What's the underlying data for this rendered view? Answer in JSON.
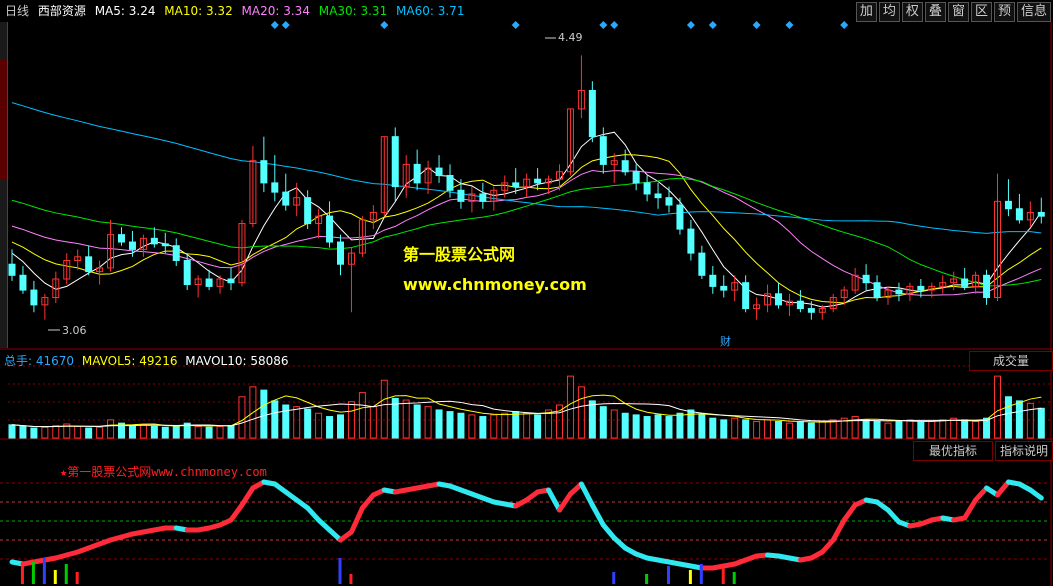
{
  "header": {
    "period": "日线",
    "stock_name": "西部资源",
    "ma5": "MA5: 3.24",
    "ma10": "MA10: 3.32",
    "ma20": "MA20: 3.34",
    "ma30": "MA30: 3.31",
    "ma60": "MA60: 3.71"
  },
  "toolbar": [
    "加",
    "均",
    "权",
    "叠",
    "窗",
    "区",
    "预",
    "信息"
  ],
  "watermark": {
    "cn": "第一股票公式网",
    "url": "www.chnmoney.com"
  },
  "price_labels": {
    "high": "4.49",
    "low": "3.06"
  },
  "finance_marker": "财",
  "volume_header": {
    "total": "总手: 41670",
    "mavol5": "MAVOL5: 49216",
    "mavol10": "MAVOL10: 58086"
  },
  "volume_button": "成交量",
  "indicator_buttons": {
    "best": "最优指标",
    "explain": "指标说明"
  },
  "indicator_title": "★第一股票公式网www.chnmoney.com",
  "colors": {
    "up": "#ff3232",
    "down": "#54ffff",
    "ma5": "#ffffff",
    "ma10": "#ffff00",
    "ma20": "#ff80ff",
    "ma30": "#00e600",
    "ma60": "#00c0ff",
    "grid_red": "#8b0000"
  },
  "chart_data": {
    "type": "candlestick",
    "y_range": [
      2.95,
      4.6
    ],
    "candles": [
      [
        3.36,
        3.44,
        3.27,
        3.3
      ],
      [
        3.3,
        3.35,
        3.2,
        3.22
      ],
      [
        3.22,
        3.27,
        3.1,
        3.14
      ],
      [
        3.14,
        3.2,
        3.06,
        3.18
      ],
      [
        3.18,
        3.32,
        3.15,
        3.28
      ],
      [
        3.28,
        3.42,
        3.25,
        3.38
      ],
      [
        3.38,
        3.44,
        3.33,
        3.4
      ],
      [
        3.4,
        3.46,
        3.3,
        3.32
      ],
      [
        3.32,
        3.38,
        3.25,
        3.34
      ],
      [
        3.34,
        3.6,
        3.32,
        3.52
      ],
      [
        3.52,
        3.56,
        3.46,
        3.48
      ],
      [
        3.48,
        3.54,
        3.4,
        3.44
      ],
      [
        3.44,
        3.52,
        3.4,
        3.5
      ],
      [
        3.5,
        3.56,
        3.45,
        3.47
      ],
      [
        3.47,
        3.53,
        3.42,
        3.46
      ],
      [
        3.46,
        3.5,
        3.35,
        3.38
      ],
      [
        3.38,
        3.42,
        3.22,
        3.25
      ],
      [
        3.25,
        3.3,
        3.18,
        3.28
      ],
      [
        3.28,
        3.33,
        3.22,
        3.24
      ],
      [
        3.24,
        3.3,
        3.2,
        3.28
      ],
      [
        3.28,
        3.34,
        3.22,
        3.26
      ],
      [
        3.26,
        3.6,
        3.24,
        3.58
      ],
      [
        3.58,
        4.0,
        3.56,
        3.92
      ],
      [
        3.92,
        4.05,
        3.75,
        3.8
      ],
      [
        3.8,
        3.95,
        3.7,
        3.75
      ],
      [
        3.75,
        3.85,
        3.65,
        3.68
      ],
      [
        3.68,
        3.8,
        3.62,
        3.72
      ],
      [
        3.72,
        3.76,
        3.55,
        3.58
      ],
      [
        3.58,
        3.66,
        3.5,
        3.62
      ],
      [
        3.62,
        3.7,
        3.45,
        3.48
      ],
      [
        3.48,
        3.52,
        3.3,
        3.36
      ],
      [
        3.36,
        3.45,
        3.1,
        3.42
      ],
      [
        3.42,
        3.62,
        3.4,
        3.6
      ],
      [
        3.6,
        3.68,
        3.55,
        3.64
      ],
      [
        3.64,
        4.05,
        3.62,
        4.05
      ],
      [
        4.05,
        4.1,
        3.7,
        3.78
      ],
      [
        3.78,
        3.95,
        3.72,
        3.9
      ],
      [
        3.9,
        3.98,
        3.76,
        3.8
      ],
      [
        3.8,
        3.92,
        3.74,
        3.88
      ],
      [
        3.88,
        3.95,
        3.8,
        3.84
      ],
      [
        3.84,
        3.9,
        3.72,
        3.76
      ],
      [
        3.76,
        3.82,
        3.66,
        3.7
      ],
      [
        3.7,
        3.78,
        3.64,
        3.74
      ],
      [
        3.74,
        3.8,
        3.66,
        3.7
      ],
      [
        3.7,
        3.78,
        3.65,
        3.76
      ],
      [
        3.76,
        3.84,
        3.72,
        3.8
      ],
      [
        3.8,
        3.88,
        3.74,
        3.78
      ],
      [
        3.78,
        3.85,
        3.72,
        3.82
      ],
      [
        3.82,
        3.88,
        3.76,
        3.8
      ],
      [
        3.8,
        3.84,
        3.74,
        3.82
      ],
      [
        3.82,
        3.9,
        3.76,
        3.86
      ],
      [
        3.86,
        4.2,
        3.84,
        4.2
      ],
      [
        4.2,
        4.49,
        4.15,
        4.3
      ],
      [
        4.3,
        4.35,
        4.02,
        4.05
      ],
      [
        4.05,
        4.1,
        3.85,
        3.9
      ],
      [
        3.9,
        3.96,
        3.8,
        3.92
      ],
      [
        3.92,
        3.98,
        3.84,
        3.86
      ],
      [
        3.86,
        3.9,
        3.76,
        3.8
      ],
      [
        3.8,
        3.84,
        3.7,
        3.74
      ],
      [
        3.74,
        3.8,
        3.66,
        3.72
      ],
      [
        3.72,
        3.78,
        3.64,
        3.68
      ],
      [
        3.68,
        3.72,
        3.52,
        3.55
      ],
      [
        3.55,
        3.6,
        3.38,
        3.42
      ],
      [
        3.42,
        3.46,
        3.28,
        3.3
      ],
      [
        3.3,
        3.35,
        3.2,
        3.24
      ],
      [
        3.24,
        3.3,
        3.18,
        3.22
      ],
      [
        3.22,
        3.3,
        3.16,
        3.26
      ],
      [
        3.26,
        3.3,
        3.1,
        3.12
      ],
      [
        3.12,
        3.18,
        3.06,
        3.14
      ],
      [
        3.14,
        3.25,
        3.1,
        3.2
      ],
      [
        3.2,
        3.26,
        3.12,
        3.14
      ],
      [
        3.14,
        3.2,
        3.08,
        3.16
      ],
      [
        3.16,
        3.22,
        3.1,
        3.12
      ],
      [
        3.12,
        3.16,
        3.06,
        3.1
      ],
      [
        3.1,
        3.14,
        3.06,
        3.12
      ],
      [
        3.12,
        3.2,
        3.1,
        3.18
      ],
      [
        3.18,
        3.24,
        3.14,
        3.22
      ],
      [
        3.22,
        3.34,
        3.2,
        3.3
      ],
      [
        3.3,
        3.36,
        3.22,
        3.26
      ],
      [
        3.26,
        3.3,
        3.16,
        3.18
      ],
      [
        3.18,
        3.24,
        3.14,
        3.22
      ],
      [
        3.22,
        3.26,
        3.16,
        3.2
      ],
      [
        3.2,
        3.26,
        3.16,
        3.24
      ],
      [
        3.24,
        3.28,
        3.18,
        3.22
      ],
      [
        3.22,
        3.26,
        3.18,
        3.24
      ],
      [
        3.24,
        3.3,
        3.2,
        3.26
      ],
      [
        3.26,
        3.32,
        3.22,
        3.28
      ],
      [
        3.28,
        3.34,
        3.22,
        3.24
      ],
      [
        3.24,
        3.32,
        3.2,
        3.3
      ],
      [
        3.3,
        3.33,
        3.14,
        3.18
      ],
      [
        3.18,
        3.85,
        3.16,
        3.7
      ],
      [
        3.7,
        3.82,
        3.62,
        3.66
      ],
      [
        3.66,
        3.74,
        3.58,
        3.6
      ],
      [
        3.6,
        3.7,
        3.56,
        3.64
      ],
      [
        3.64,
        3.72,
        3.58,
        3.62
      ]
    ],
    "volume": [
      16,
      14,
      12,
      13,
      15,
      17,
      14,
      12,
      13,
      22,
      18,
      15,
      16,
      14,
      13,
      15,
      18,
      14,
      13,
      14,
      15,
      50,
      62,
      58,
      45,
      40,
      38,
      35,
      30,
      26,
      28,
      44,
      55,
      38,
      70,
      48,
      46,
      40,
      38,
      34,
      32,
      30,
      28,
      26,
      28,
      30,
      32,
      30,
      28,
      34,
      40,
      75,
      62,
      45,
      38,
      34,
      30,
      28,
      26,
      28,
      26,
      30,
      34,
      28,
      24,
      22,
      24,
      22,
      20,
      22,
      20,
      18,
      20,
      18,
      20,
      22,
      24,
      26,
      22,
      20,
      18,
      20,
      22,
      20,
      20,
      22,
      24,
      22,
      20,
      24,
      75,
      50,
      45,
      42,
      36
    ],
    "indicator": [
      0.18,
      0.16,
      0.18,
      0.2,
      0.22,
      0.25,
      0.28,
      0.32,
      0.36,
      0.4,
      0.43,
      0.46,
      0.48,
      0.5,
      0.52,
      0.52,
      0.5,
      0.5,
      0.52,
      0.55,
      0.6,
      0.75,
      0.92,
      0.98,
      0.96,
      0.88,
      0.8,
      0.72,
      0.6,
      0.5,
      0.4,
      0.48,
      0.72,
      0.85,
      0.9,
      0.88,
      0.9,
      0.92,
      0.94,
      0.96,
      0.94,
      0.9,
      0.86,
      0.82,
      0.78,
      0.76,
      0.74,
      0.8,
      0.88,
      0.9,
      0.7,
      0.86,
      0.96,
      0.75,
      0.55,
      0.42,
      0.32,
      0.26,
      0.22,
      0.2,
      0.18,
      0.16,
      0.14,
      0.12,
      0.12,
      0.14,
      0.16,
      0.2,
      0.24,
      0.25,
      0.24,
      0.22,
      0.2,
      0.22,
      0.28,
      0.4,
      0.6,
      0.75,
      0.8,
      0.78,
      0.7,
      0.58,
      0.54,
      0.56,
      0.6,
      0.62,
      0.6,
      0.62,
      0.8,
      0.92,
      0.85,
      0.98,
      0.96,
      0.9,
      0.82
    ],
    "blue_markers_x": [
      24,
      25,
      34,
      46,
      54,
      55,
      62,
      64,
      68,
      71,
      76,
      97
    ]
  }
}
